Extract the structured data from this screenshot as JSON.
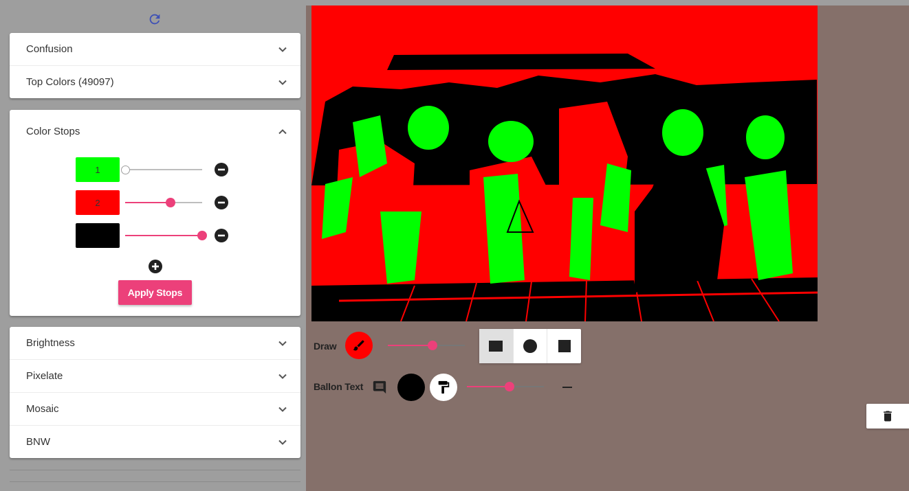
{
  "sidebar": {
    "panels_top": [
      {
        "label": "Confusion"
      },
      {
        "label": "Top Colors (49097)"
      }
    ],
    "color_stops": {
      "title": "Color Stops",
      "stops": [
        {
          "label": "1",
          "color": "#00ff00",
          "value": 0
        },
        {
          "label": "2",
          "color": "#ff0000",
          "value": 0.59
        },
        {
          "label": "",
          "color": "#000000",
          "value": 1
        }
      ],
      "apply_label": "Apply Stops"
    },
    "panels_bottom": [
      {
        "label": "Brightness"
      },
      {
        "label": "Pixelate"
      },
      {
        "label": "Mosaic"
      },
      {
        "label": "BNW"
      }
    ]
  },
  "tools": {
    "draw_label": "Draw",
    "draw_color": "#ff0000",
    "draw_size": 0.58,
    "balloon_label": "Ballon Text",
    "balloon_color": "#000000",
    "balloon_size": 0.55,
    "shapes": [
      "square-icon",
      "circle-icon",
      "square-filled-icon"
    ]
  },
  "colors": {
    "accent": "#ec407a",
    "image_palette": [
      "#ff0000",
      "#00ff00",
      "#000000"
    ]
  }
}
